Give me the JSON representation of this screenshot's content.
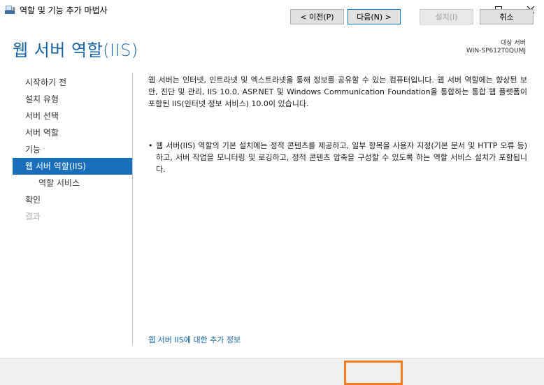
{
  "window": {
    "title": "역할 및 기능 추가 마법사",
    "icon": "server-manager-icon"
  },
  "header": {
    "title": "웹 서버 역할(IIS)",
    "target_label": "대상 서버",
    "target_value": "WIN-SP612T0QUMJ"
  },
  "sidebar": {
    "items": [
      {
        "label": "시작하기 전",
        "state": "normal"
      },
      {
        "label": "설치 유형",
        "state": "normal"
      },
      {
        "label": "서버 선택",
        "state": "normal"
      },
      {
        "label": "서버 역할",
        "state": "normal"
      },
      {
        "label": "기능",
        "state": "normal"
      },
      {
        "label": "웹 서버 역할(IIS)",
        "state": "active"
      },
      {
        "label": "역할 서비스",
        "state": "sub"
      },
      {
        "label": "확인",
        "state": "normal"
      },
      {
        "label": "결과",
        "state": "disabled"
      }
    ]
  },
  "main": {
    "intro": "웹 서버는 인터넷, 인트라넷 및 엑스트라넷을 통해 정보를 공유할 수 있는 컴퓨터입니다. 웹 서버 역할에는 향상된 보안, 진단 및 관리, IIS 10.0, ASP.NET 및 Windows Communication Foundation을 통합하는 통합 웹 플랫폼이 포함된 IIS(인터넷 정보 서비스) 10.0이 있습니다.",
    "bullet": "웹 서버(IIS) 역할의 기본 설치에는 정적 콘텐츠를 제공하고, 일부 항목을 사용자 지정(기본 문서 및 HTTP 오류 등)하고, 서버 작업을 모니터링 및 로깅하고, 정적 콘텐츠 압축을 구성할 수 있도록 하는 역할 서비스 설치가 포함됩니다.",
    "more_info_link": "웹 서버 IIS에 대한 추가 정보"
  },
  "footer": {
    "prev_label": "< 이전(P)",
    "next_label": "다음(N) >",
    "install_label": "설치(I)",
    "cancel_label": "취소"
  },
  "colors": {
    "accent": "#1565a8",
    "active_nav": "#1a6fbc",
    "focus_highlight": "#f07f23"
  }
}
